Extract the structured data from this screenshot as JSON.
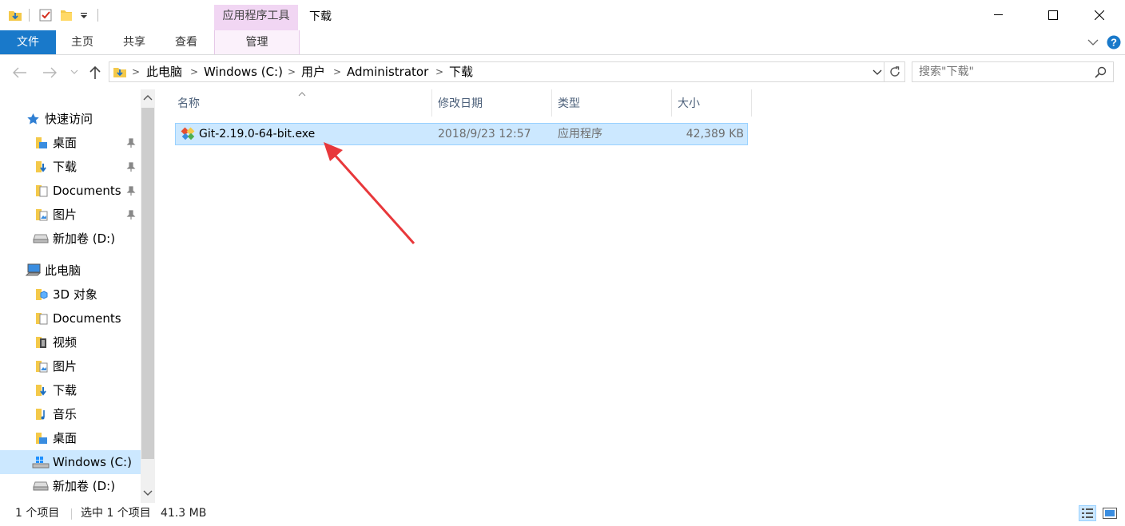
{
  "titlebar": {
    "context_tab_title": "应用程序工具",
    "window_title": "下载"
  },
  "ribbon": {
    "tabs": [
      {
        "label": "文件"
      },
      {
        "label": "主页"
      },
      {
        "label": "共享"
      },
      {
        "label": "查看"
      },
      {
        "label": "管理"
      }
    ]
  },
  "address": {
    "breadcrumbs": [
      "此电脑",
      "Windows (C:)",
      "用户",
      "Administrator",
      "下载"
    ]
  },
  "search": {
    "placeholder": "搜索\"下载\""
  },
  "nav": {
    "quick_access": "快速访问",
    "quick_items": [
      "桌面",
      "下载",
      "Documents",
      "图片",
      "新加卷 (D:)"
    ],
    "this_pc": "此电脑",
    "pc_items": [
      "3D 对象",
      "Documents",
      "视频",
      "图片",
      "下载",
      "音乐",
      "桌面",
      "Windows (C:)",
      "新加卷 (D:)"
    ]
  },
  "columns": {
    "name": "名称",
    "date": "修改日期",
    "type": "类型",
    "size": "大小"
  },
  "files": [
    {
      "name": "Git-2.19.0-64-bit.exe",
      "date": "2018/9/23 12:57",
      "type": "应用程序",
      "size": "42,389 KB"
    }
  ],
  "status": {
    "count": "1 个项目",
    "selected": "选中 1 个项目",
    "selected_size": "41.3 MB"
  },
  "colors": {
    "accent": "#1979ca",
    "selection": "#cce8ff",
    "context_tab": "#f1d6f3",
    "annotation_arrow": "#e8383b"
  }
}
